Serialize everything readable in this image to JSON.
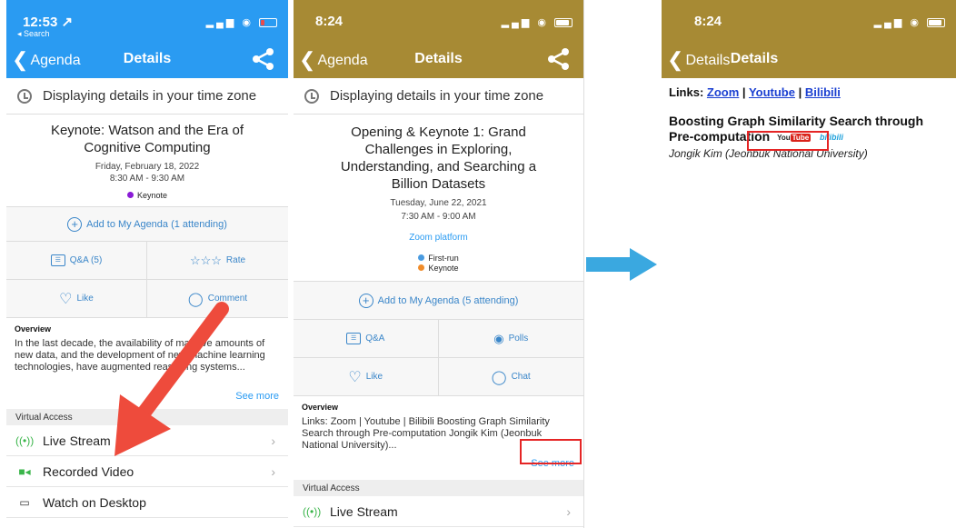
{
  "phone1": {
    "status_time": "12:53 ↗",
    "status_back": "◂ Search",
    "nav_back": "Agenda",
    "nav_title": "Details",
    "timezone_text": "Displaying details in your time zone",
    "session": {
      "title": "Keynote: Watson and the Era of Cognitive Computing",
      "date": "Friday, February 18, 2022",
      "time": "8:30 AM - 9:30 AM",
      "tags": [
        {
          "label": "Keynote",
          "color": "#8a1bd6"
        }
      ]
    },
    "add_agenda": "Add to My Agenda (1 attending)",
    "actions": [
      {
        "label": "Q&A (5)",
        "icon": "qa-icon"
      },
      {
        "label": "Rate",
        "icon": "star-icon"
      },
      {
        "label": "Like",
        "icon": "heart-icon"
      },
      {
        "label": "Comment",
        "icon": "comment-icon"
      }
    ],
    "overview_heading": "Overview",
    "overview_text": "In the last decade, the availability of massive amounts of new data, and the development of new machine learning technologies, have augmented reasoning systems...",
    "see_more": "See more",
    "virtual_access_heading": "Virtual Access",
    "virtual_access": [
      {
        "label": "Live Stream",
        "icon": "broadcast-icon"
      },
      {
        "label": "Recorded Video",
        "icon": "video-icon"
      },
      {
        "label": "Watch on Desktop",
        "icon": "monitor-icon"
      }
    ]
  },
  "phone2": {
    "status_time": "8:24",
    "nav_back": "Agenda",
    "nav_title": "Details",
    "timezone_text": "Displaying details in your time zone",
    "session": {
      "title": "Opening & Keynote 1: Grand Challenges in Exploring, Understanding, and Searching a Billion Datasets",
      "date": "Tuesday, June 22, 2021",
      "time": "7:30 AM - 9:00 AM",
      "link": "Zoom platform",
      "tags": [
        {
          "label": "First-run",
          "color": "#4a9be0"
        },
        {
          "label": "Keynote",
          "color": "#f08c2a"
        }
      ]
    },
    "add_agenda": "Add to My Agenda (5 attending)",
    "actions": [
      {
        "label": "Q&A",
        "icon": "qa-icon"
      },
      {
        "label": "Polls",
        "icon": "polls-icon"
      },
      {
        "label": "Like",
        "icon": "heart-icon"
      },
      {
        "label": "Chat",
        "icon": "chat-icon"
      }
    ],
    "overview_heading": "Overview",
    "overview_text": "Links: Zoom | Youtube | Bilibili Boosting Graph Similarity Search through Pre-computation Jongik Kim (Jeonbuk National University)...",
    "see_more": "See more",
    "virtual_access_heading": "Virtual Access",
    "virtual_access": [
      {
        "label": "Live Stream",
        "icon": "broadcast-icon"
      }
    ]
  },
  "phone3": {
    "status_time": "8:24",
    "nav_back": "Details",
    "nav_title": "Details",
    "links_label": "Links:",
    "links": [
      "Zoom",
      "Youtube",
      "Bilibili"
    ],
    "entry_title": "Boosting Graph Similarity Search through Pre-computation",
    "entry_author": "Jongik Kim (Jeonbuk National University)",
    "youtube_logo_a": "You",
    "youtube_logo_b": "Tube",
    "bilibili_logo": "bilibili"
  },
  "colors": {
    "blue_bar": "#2a9bf2",
    "gold_bar": "#a78a34",
    "highlight": "#e52525",
    "arrow_blue": "#3aa8e0",
    "arrow_red": "#ee4b3c"
  }
}
